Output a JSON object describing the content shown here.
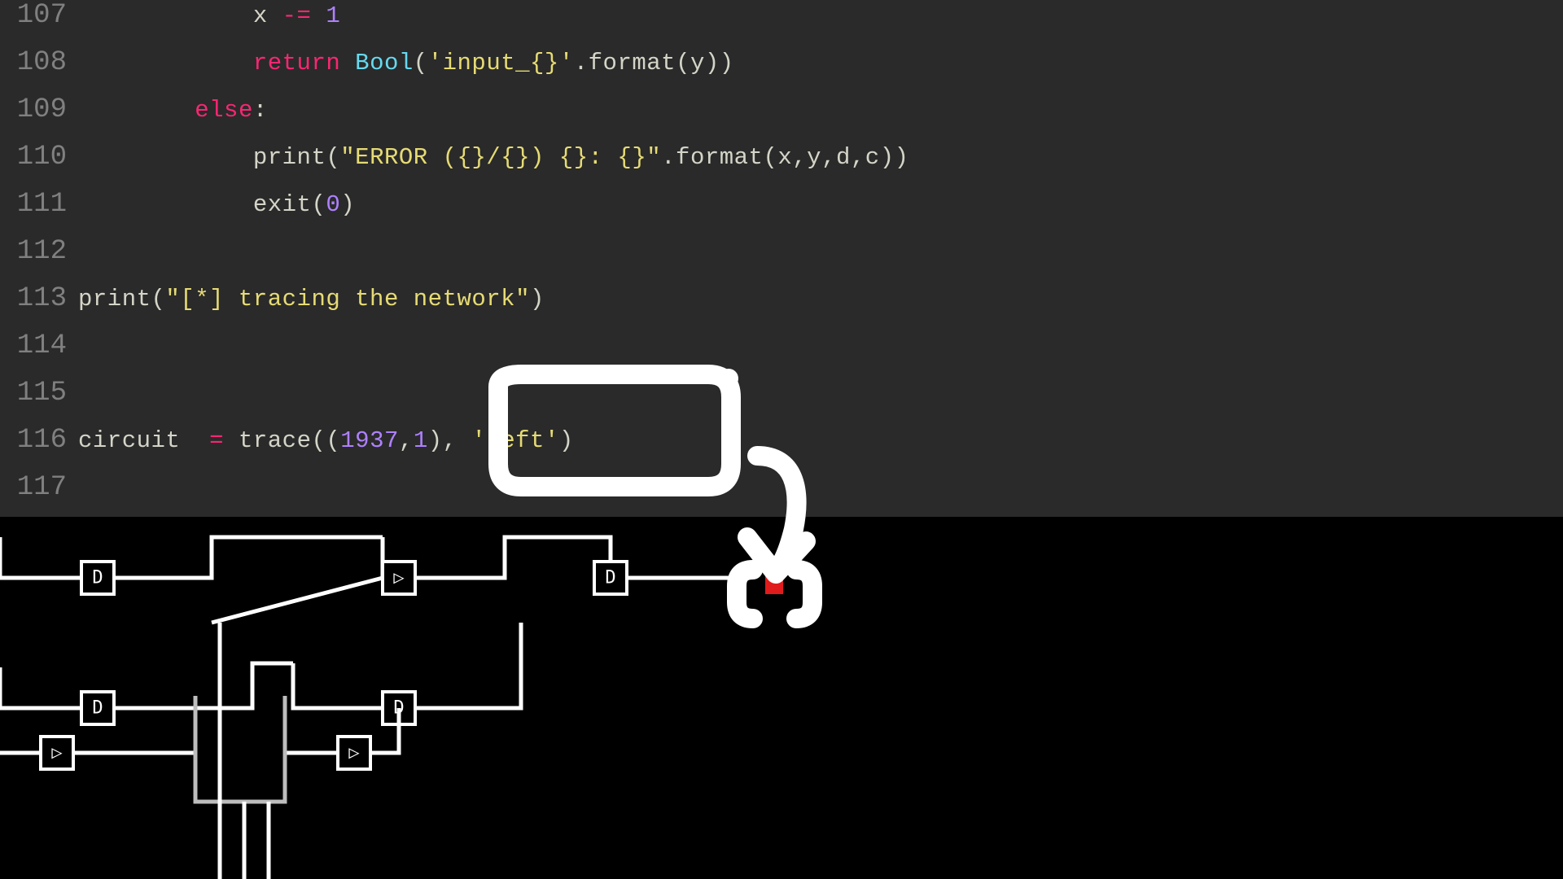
{
  "lines": {
    "107": {
      "num": "107"
    },
    "108": {
      "num": "108"
    },
    "109": {
      "num": "109"
    },
    "110": {
      "num": "110"
    },
    "111": {
      "num": "111"
    },
    "112": {
      "num": "112"
    },
    "113": {
      "num": "113"
    },
    "114": {
      "num": "114"
    },
    "115": {
      "num": "115"
    },
    "116": {
      "num": "116"
    },
    "117": {
      "num": "117"
    }
  },
  "tokens": {
    "l107_x": "x ",
    "l107_op": "-= ",
    "l107_one": "1",
    "l108_return": "return ",
    "l108_bool": "Bool",
    "l108_open": "(",
    "l108_str": "'input_{}'",
    "l108_dot": ".",
    "l108_format": "format",
    "l108_args_open": "(",
    "l108_y": "y",
    "l108_args_close": ")",
    "l108_close": ")",
    "l109_else": "else",
    "l109_colon": ":",
    "l110_print": "print",
    "l110_open": "(",
    "l110_str": "\"ERROR ({}/{}) {}: {}\"",
    "l110_dot": ".",
    "l110_format": "format",
    "l110_args": "(x,y,d,c))",
    "l111_exit": "exit",
    "l111_open": "(",
    "l111_zero": "0",
    "l111_close": ")",
    "l113_print": "print",
    "l113_open": "(",
    "l113_str": "\"[*] tracing the network\"",
    "l113_close": ")",
    "l116_circuit": "circuit  ",
    "l116_eq": "= ",
    "l116_trace": "trace",
    "l116_open": "(",
    "l116_tuple_open": "(",
    "l116_n": "1937",
    "l116_comma": ",",
    "l116_one": "1",
    "l116_tuple_close": ")",
    "l116_sep": ", ",
    "l116_left": "'left'",
    "l116_close": ")"
  },
  "indent": {
    "i12": "            ",
    "i8": "        ",
    "i0": ""
  },
  "circuit": {
    "gate_labels": {
      "d": "D",
      "and": "▷",
      "or": "▷"
    }
  }
}
